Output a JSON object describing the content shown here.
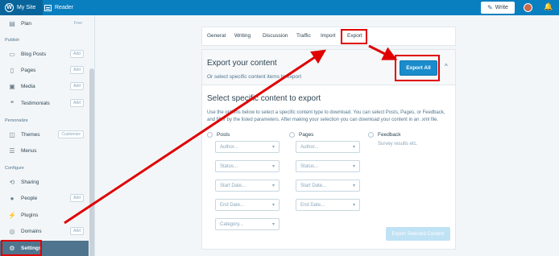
{
  "topbar": {
    "my_site": "My Site",
    "reader": "Reader",
    "write": "Write",
    "wp_logo": "W",
    "pen_glyph": "✎",
    "bell_glyph": "🔔"
  },
  "sidebar": {
    "plan": {
      "label": "Plan",
      "badge": "Free"
    },
    "publish_heading": "Publish",
    "publish_items": [
      {
        "label": "Blog Posts",
        "badge": "Add",
        "icon": "document-icon"
      },
      {
        "label": "Pages",
        "badge": "Add",
        "icon": "pages-icon"
      },
      {
        "label": "Media",
        "badge": "Add",
        "icon": "media-icon"
      },
      {
        "label": "Testimonials",
        "badge": "Add",
        "icon": "quote-icon"
      }
    ],
    "personalize_heading": "Personalize",
    "themes": {
      "label": "Themes",
      "badge": "Customize"
    },
    "menus": {
      "label": "Menus"
    },
    "configure_heading": "Configure",
    "configure_items": [
      {
        "label": "Sharing",
        "badge": "",
        "icon": "share-icon"
      },
      {
        "label": "People",
        "badge": "Add",
        "icon": "person-icon"
      },
      {
        "label": "Plugins",
        "badge": "",
        "icon": "plugin-icon"
      },
      {
        "label": "Domains",
        "badge": "Add",
        "icon": "globe-icon"
      }
    ],
    "settings": {
      "label": "Settings"
    }
  },
  "tabs": [
    "General",
    "Writing",
    "Discussion",
    "Traffic",
    "Import",
    "Export"
  ],
  "export": {
    "title": "Export your content",
    "subtitle": "Or select specific content items to export",
    "export_all": "Export All",
    "chevron": "^",
    "section_title": "Select specific content to export",
    "description": "Use the options below to select a specific content type to download. You can select Posts, Pages, or Feedback, and filter by the listed parameters. After making your selection you can download your content in an .xml file.",
    "posts": {
      "label": "Posts",
      "fields": [
        "Author...",
        "Status...",
        "Start Date...",
        "End Date...",
        "Category..."
      ]
    },
    "pages": {
      "label": "Pages",
      "fields": [
        "Author...",
        "Status...",
        "Start Date...",
        "End Date..."
      ]
    },
    "feedback": {
      "label": "Feedback",
      "sub": "Survey results etc."
    },
    "export_selected": "Export Selected Content"
  },
  "colors": {
    "accent": "#0a7fbf",
    "annotation": "#e00000"
  }
}
